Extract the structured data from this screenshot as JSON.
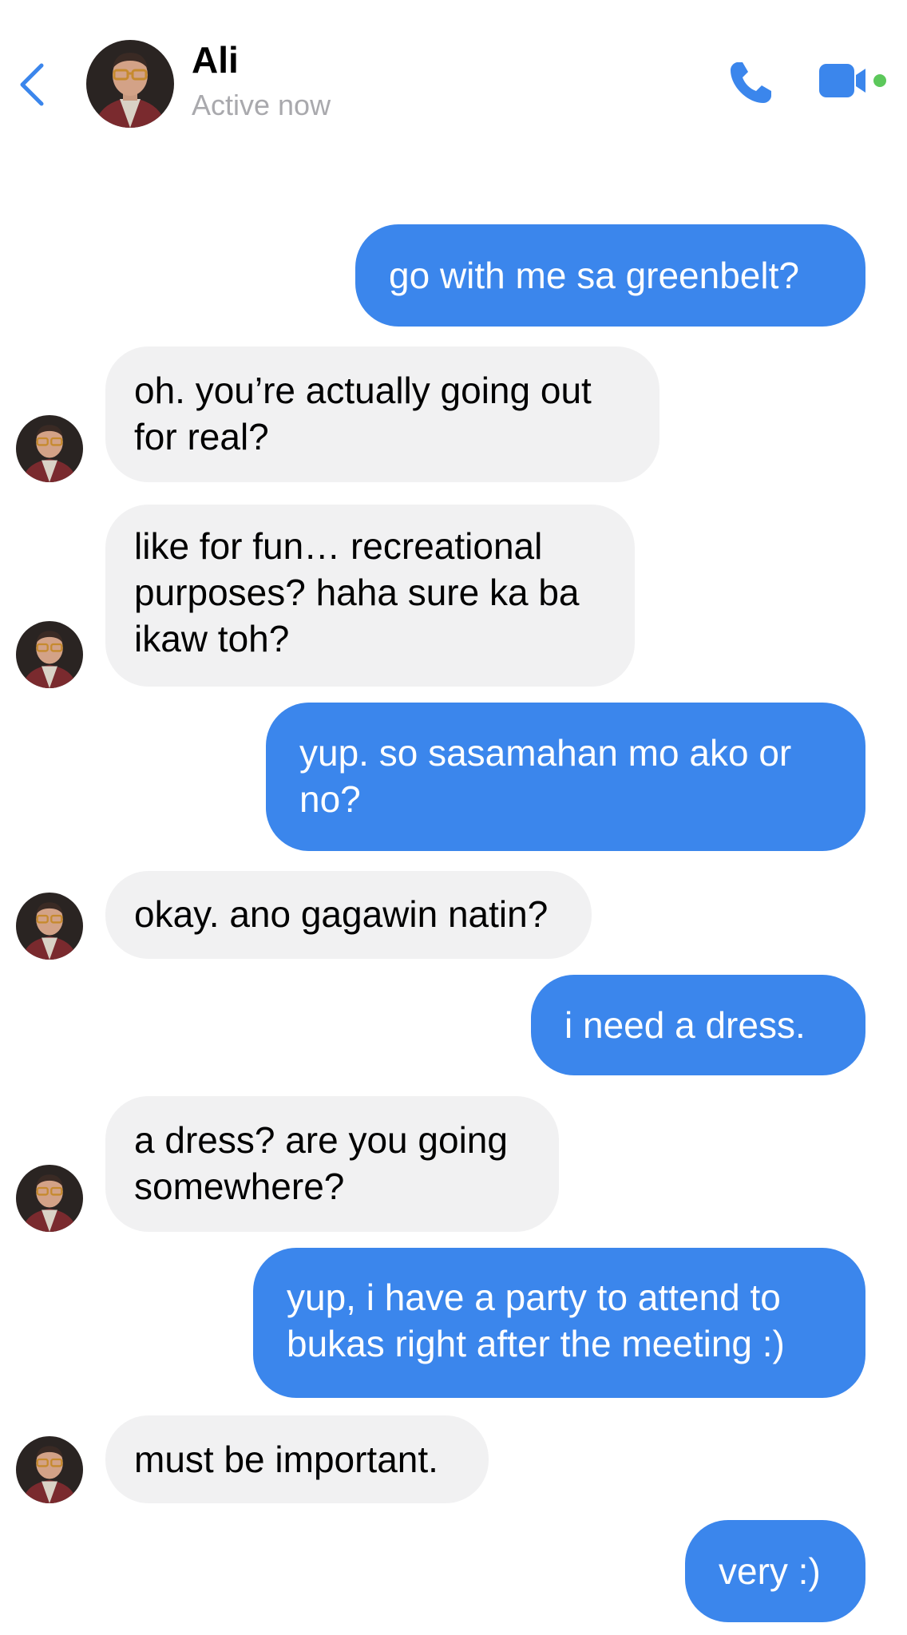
{
  "header": {
    "back_icon": "chevron-left-icon",
    "contact_name": "Ali",
    "status": "Active now",
    "call_icon": "phone-icon",
    "video_icon": "video-camera-icon",
    "online_indicator_color": "#5cc85b",
    "accent_color": "#3b86ec"
  },
  "messages": [
    {
      "from": "me",
      "text": "go with me sa greenbelt?"
    },
    {
      "from": "Ali",
      "text": "oh. you’re actually going out\nfor real?"
    },
    {
      "from": "Ali",
      "text": "like for fun… recreational\npurposes? haha sure ka ba\nikaw toh?"
    },
    {
      "from": "me",
      "text": "yup. so sasamahan mo ako or\nno?"
    },
    {
      "from": "Ali",
      "text": "okay. ano gagawin natin?"
    },
    {
      "from": "me",
      "text": "i need a dress."
    },
    {
      "from": "Ali",
      "text": "a dress? are you going\nsomewhere?"
    },
    {
      "from": "me",
      "text": "yup, i have a party to attend to\nbukas right after the meeting :)"
    },
    {
      "from": "Ali",
      "text": "must be important."
    },
    {
      "from": "me",
      "text": "very :)"
    }
  ],
  "colors": {
    "outgoing_bubble": "#3b86ec",
    "incoming_bubble": "#f1f1f2",
    "status_text": "#a9a9ad"
  }
}
